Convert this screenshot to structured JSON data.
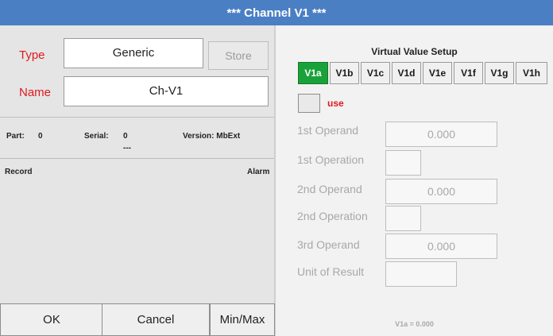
{
  "window": {
    "title": "***   Channel V1   ***"
  },
  "left_panel": {
    "type_label": "Type",
    "type_value": "Generic",
    "store_label": "Store",
    "name_label": "Name",
    "name_value": "Ch-V1",
    "info": {
      "part_label": "Part:",
      "part_value": "0",
      "serial_label": "Serial:",
      "serial_value": "0",
      "serial_sub": "---",
      "version_label": "Version: MbExt"
    },
    "record_label": "Record",
    "alarm_label": "Alarm",
    "buttons": {
      "ok": "OK",
      "cancel": "Cancel",
      "minmax": "Min/Max"
    }
  },
  "virtual_setup": {
    "title": "Virtual Value Setup",
    "tabs": [
      "V1a",
      "V1b",
      "V1c",
      "V1d",
      "V1e",
      "V1f",
      "V1g",
      "V1h"
    ],
    "active_tab": "V1a",
    "use_label": "use",
    "rows": {
      "op1_label": "1st Operand",
      "op1_value": "0.000",
      "opn1_label": "1st Operation",
      "opn1_value": "",
      "op2_label": "2nd Operand",
      "op2_value": "0.000",
      "opn2_label": "2nd Operation",
      "opn2_value": "",
      "op3_label": "3rd Operand",
      "op3_value": "0.000",
      "unit_label": "Unit of Result",
      "unit_value": ""
    },
    "result_text": "V1a = 0.000"
  },
  "colors": {
    "title_bar": "#4a7fc4",
    "active_tab": "#1aa23a",
    "label_red": "#e0191e",
    "disabled_text": "#a8a8a8"
  }
}
